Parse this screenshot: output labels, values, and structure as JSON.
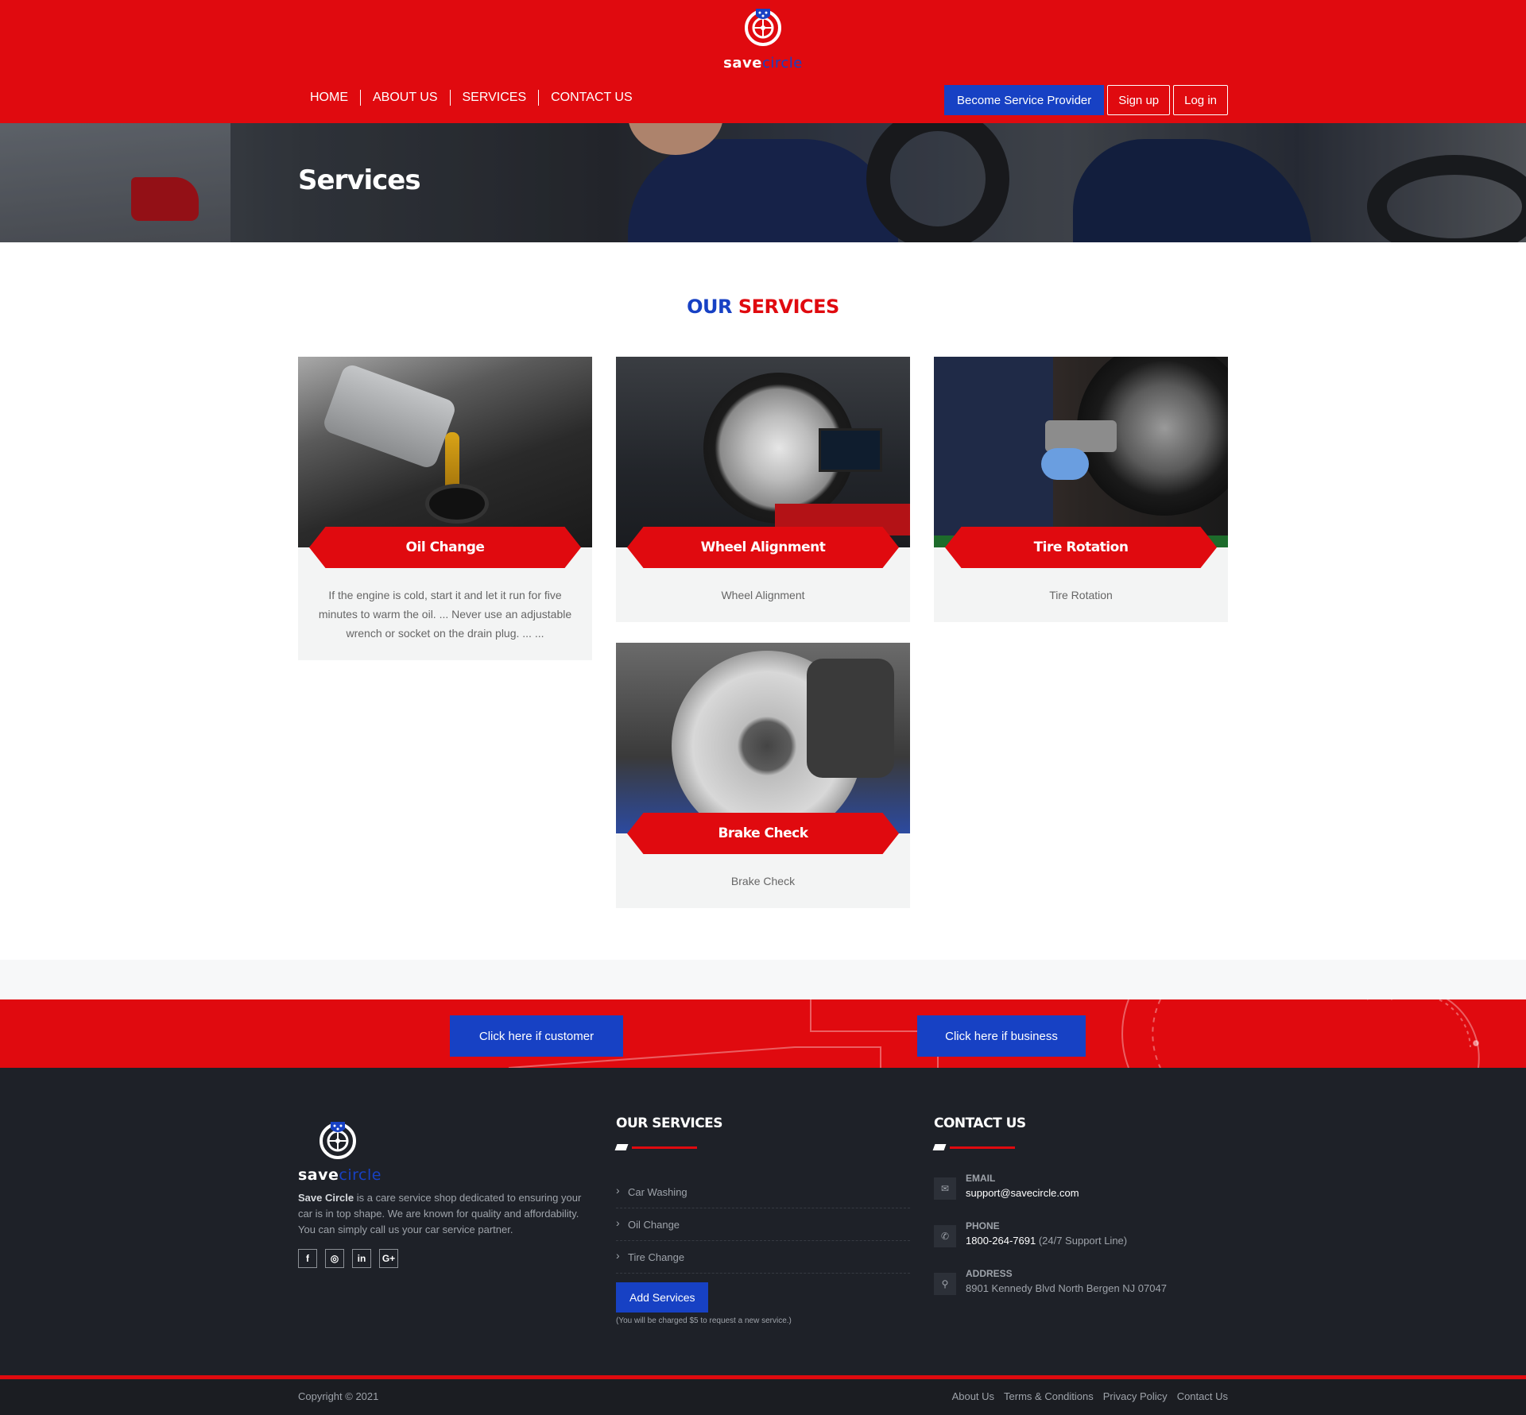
{
  "brand": {
    "logo_main": "save",
    "logo_accent": "circle"
  },
  "header": {
    "nav": [
      "HOME",
      "ABOUT US",
      "SERVICES",
      "CONTACT US"
    ],
    "become_provider": "Become Service Provider",
    "signup": "Sign up",
    "login": "Log in"
  },
  "banner": {
    "title": "Services"
  },
  "services": {
    "title_blue": "OUR",
    "title_red": "SERVICES",
    "cards": [
      {
        "title": "Oil Change",
        "description": "If the engine is cold, start it and let it run for five minutes to warm the oil. ... Never use an adjustable wrench or socket on the drain plug. ... ..."
      },
      {
        "title": "Wheel Alignment",
        "description": "Wheel Alignment"
      },
      {
        "title": "Tire Rotation",
        "description": "Tire Rotation"
      },
      {
        "title": "Brake Check",
        "description": "Brake Check"
      }
    ]
  },
  "cta": {
    "customer": "Click here if customer",
    "business": "Click here if business"
  },
  "footer": {
    "about_strong": "Save Circle",
    "about_text": " is a care service shop dedicated to ensuring your car is in top shape. We are known for quality and affordability. You can simply call us your car service partner.",
    "socials": [
      "f",
      "◎",
      "in",
      "G+"
    ],
    "services_title": "OUR SERVICES",
    "services_list": [
      "Car Washing",
      "Oil Change",
      "Tire Change"
    ],
    "add_services": "Add Services",
    "add_note": "(You will be charged $5 to request a new service.)",
    "contact_title": "CONTACT US",
    "email_label": "EMAIL",
    "email_value": "support@savecircle.com",
    "phone_label": "PHONE",
    "phone_value": "1800-264-7691",
    "phone_note": " (24/7 Support Line)",
    "address_label": "ADDRESS",
    "address_value": "8901 Kennedy Blvd North Bergen NJ 07047",
    "copyright": "Copyright © 2021",
    "bottom_links": [
      "About Us",
      "Terms & Conditions",
      "Privacy Policy",
      "Contact Us"
    ]
  },
  "colors": {
    "brand_red": "#e00a0f",
    "brand_blue": "#1741c4",
    "footer_dark": "#1e2128"
  }
}
